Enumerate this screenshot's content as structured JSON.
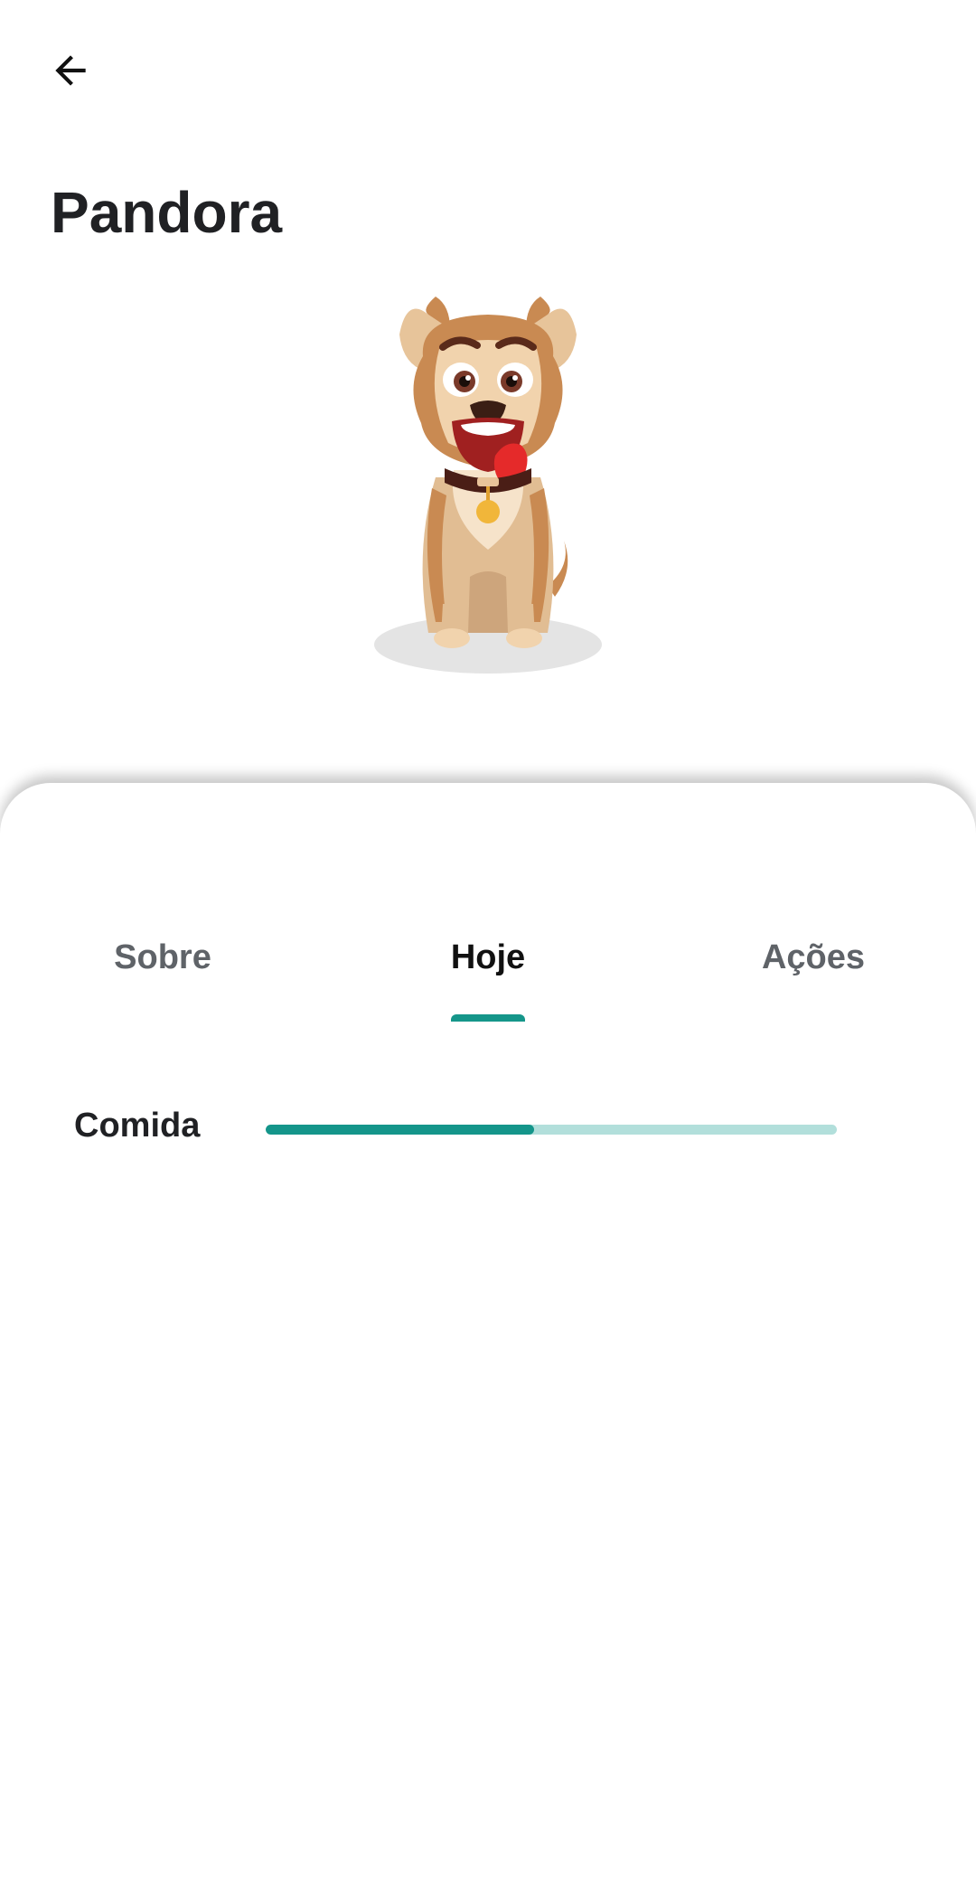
{
  "header": {
    "back_icon": "arrow-back-icon",
    "title": "Pandora"
  },
  "pet": {
    "illustration": "cartoon-dog-illustration"
  },
  "tabs": [
    {
      "label": "Sobre",
      "active": false
    },
    {
      "label": "Hoje",
      "active": true
    },
    {
      "label": "Ações",
      "active": false
    }
  ],
  "stats": {
    "food": {
      "label": "Comida",
      "progress_fraction": 0.47
    }
  },
  "colors": {
    "accent": "#14958a",
    "accent_light": "#b2dfdb",
    "title_text": "#202124",
    "inactive_tab": "#5f6368"
  }
}
